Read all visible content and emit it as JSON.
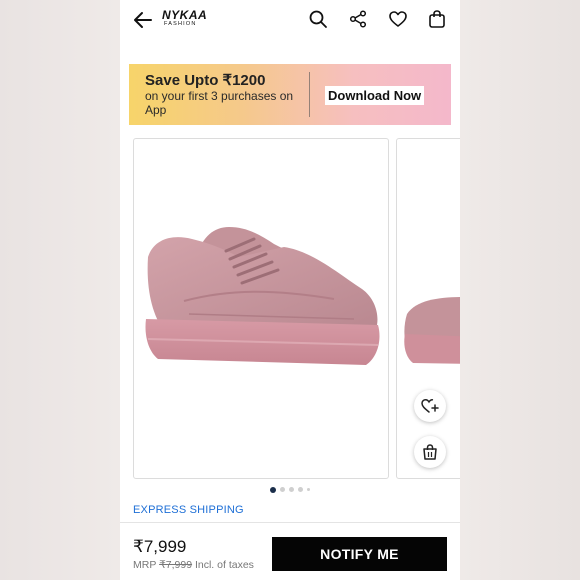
{
  "header": {
    "logo_brand": "NYKAA",
    "logo_sub": "FASHION",
    "icons": [
      "back-arrow-icon",
      "search-icon",
      "share-icon",
      "heart-icon",
      "bag-icon"
    ]
  },
  "banner": {
    "title": "Save Upto ₹1200",
    "subtitle": "on your first 3 purchases on App",
    "cta": "Download Now"
  },
  "gallery": {
    "image_subject": "pink leather platform sneakers",
    "dots_total": 5,
    "active_dot": 0,
    "fab_icons": [
      "heart-plus-icon",
      "bag-icon"
    ]
  },
  "shipping_label": "EXPRESS SHIPPING",
  "price": {
    "current": "₹7,999",
    "mrp_label": "MRP",
    "mrp_value": "₹7,999",
    "tax_note": "Incl. of taxes"
  },
  "actions": {
    "notify_label": "NOTIFY ME"
  },
  "colors": {
    "accent_blue": "#1e6fd6",
    "button_black": "#050505",
    "shoe_pink": "#c9949c"
  }
}
